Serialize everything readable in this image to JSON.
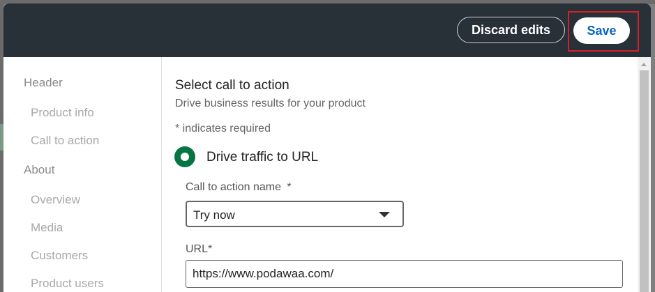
{
  "toolbar": {
    "discard_label": "Discard edits",
    "save_label": "Save"
  },
  "sidebar": {
    "sections": [
      {
        "label": "Header",
        "items": [
          "Product info",
          "Call to action"
        ]
      },
      {
        "label": "About",
        "items": [
          "Overview",
          "Media",
          "Customers",
          "Product users"
        ]
      }
    ]
  },
  "form": {
    "heading": "Select call to action",
    "subheading": "Drive business results for your product",
    "required_note": "* indicates required",
    "radio_option": {
      "label": "Drive traffic to URL",
      "selected": true
    },
    "cta_name": {
      "label": "Call to action name",
      "required_marker": "*",
      "value": "Try now"
    },
    "url": {
      "label": "URL",
      "required_marker": "*",
      "value": "https://www.podawaa.com/"
    }
  },
  "colors": {
    "topbar_bg": "#283038",
    "primary_blue": "#0a66c2",
    "radio_green": "#057642",
    "highlight_red": "#d4202a"
  }
}
